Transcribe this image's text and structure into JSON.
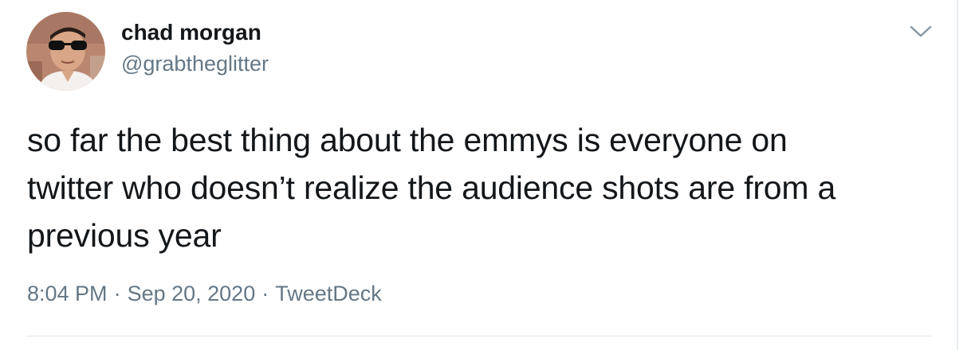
{
  "author": {
    "display_name": "chad morgan",
    "handle": "@grabtheglitter",
    "avatar_icon": "profile-photo-avatar"
  },
  "tweet": {
    "text_lines": [
      "so far the best thing about the emmys is everyone on",
      "twitter who doesn’t realize the audience shots are from a",
      "previous year"
    ],
    "time": "8:04 PM",
    "date": "Sep 20, 2020",
    "source": "TweetDeck",
    "separator": "·"
  },
  "menu": {
    "icon": "chevron-down-icon"
  },
  "colors": {
    "text_primary": "#14171a",
    "text_secondary": "#657786",
    "border": "#e6ecf0"
  }
}
